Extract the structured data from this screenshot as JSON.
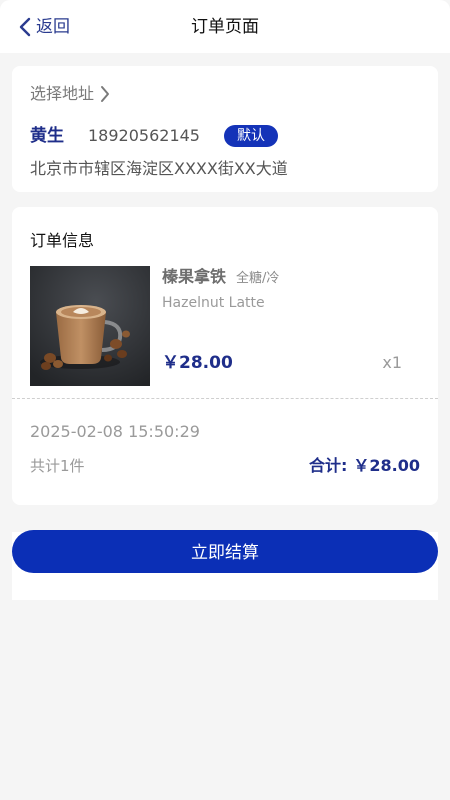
{
  "header": {
    "back_label": "返回",
    "title": "订单页面"
  },
  "address": {
    "select_label": "选择地址",
    "name": "黄生",
    "phone": "18920562145",
    "default_badge": "默认",
    "detail": "北京市市辖区海淀区XXXX街XX大道"
  },
  "order": {
    "heading": "订单信息",
    "product": {
      "name": "榛果拿铁",
      "spec": "全糖/冷",
      "english_name": "Hazelnut Latte",
      "price": "￥28.00",
      "quantity": "x1"
    },
    "time": "2025-02-08 15:50:29",
    "count_label": "共计1件",
    "total_label": "合计:",
    "total_value": "￥28.00"
  },
  "checkout": {
    "button_label": "立即结算"
  },
  "colors": {
    "accent": "#1433b8",
    "accent_dark": "#1f2e8a",
    "background": "#f5f5f5"
  }
}
